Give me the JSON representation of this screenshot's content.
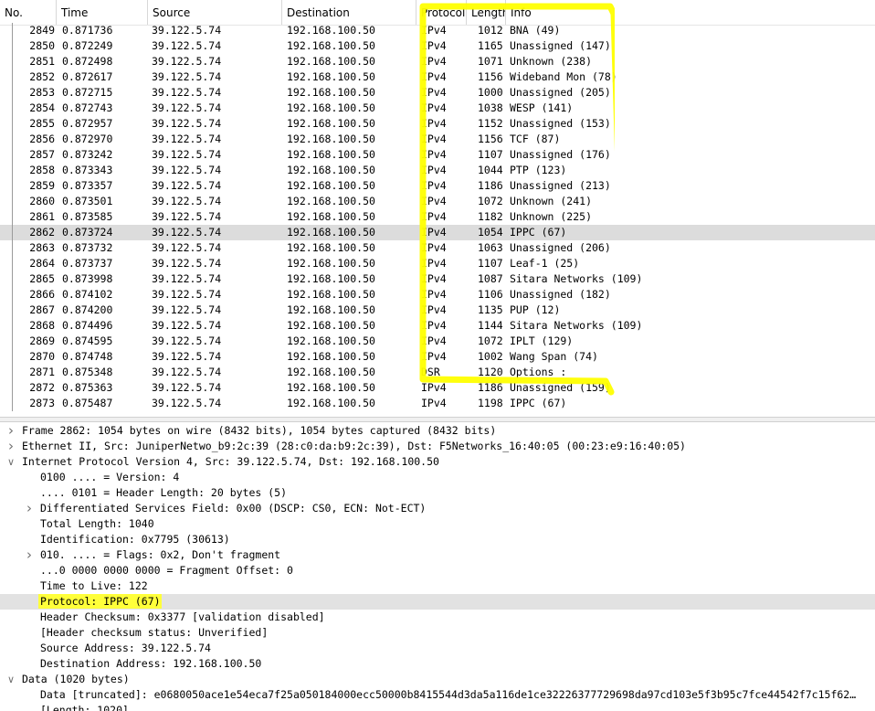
{
  "columns": {
    "no": "No.",
    "time": "Time",
    "source": "Source",
    "destination": "Destination",
    "protocol": "Protocol",
    "length": "Length",
    "info": "Info"
  },
  "packets": [
    {
      "no": "2849",
      "time": "0.871736",
      "src": "39.122.5.74",
      "dst": "192.168.100.50",
      "proto": "IPv4",
      "len": "1012",
      "info": "BNA (49)"
    },
    {
      "no": "2850",
      "time": "0.872249",
      "src": "39.122.5.74",
      "dst": "192.168.100.50",
      "proto": "IPv4",
      "len": "1165",
      "info": "Unassigned (147)"
    },
    {
      "no": "2851",
      "time": "0.872498",
      "src": "39.122.5.74",
      "dst": "192.168.100.50",
      "proto": "IPv4",
      "len": "1071",
      "info": "Unknown (238)"
    },
    {
      "no": "2852",
      "time": "0.872617",
      "src": "39.122.5.74",
      "dst": "192.168.100.50",
      "proto": "IPv4",
      "len": "1156",
      "info": "Wideband Mon (78)"
    },
    {
      "no": "2853",
      "time": "0.872715",
      "src": "39.122.5.74",
      "dst": "192.168.100.50",
      "proto": "IPv4",
      "len": "1000",
      "info": "Unassigned (205)"
    },
    {
      "no": "2854",
      "time": "0.872743",
      "src": "39.122.5.74",
      "dst": "192.168.100.50",
      "proto": "IPv4",
      "len": "1038",
      "info": "WESP (141)"
    },
    {
      "no": "2855",
      "time": "0.872957",
      "src": "39.122.5.74",
      "dst": "192.168.100.50",
      "proto": "IPv4",
      "len": "1152",
      "info": "Unassigned (153)"
    },
    {
      "no": "2856",
      "time": "0.872970",
      "src": "39.122.5.74",
      "dst": "192.168.100.50",
      "proto": "IPv4",
      "len": "1156",
      "info": "TCF (87)"
    },
    {
      "no": "2857",
      "time": "0.873242",
      "src": "39.122.5.74",
      "dst": "192.168.100.50",
      "proto": "IPv4",
      "len": "1107",
      "info": "Unassigned (176)"
    },
    {
      "no": "2858",
      "time": "0.873343",
      "src": "39.122.5.74",
      "dst": "192.168.100.50",
      "proto": "IPv4",
      "len": "1044",
      "info": "PTP (123)"
    },
    {
      "no": "2859",
      "time": "0.873357",
      "src": "39.122.5.74",
      "dst": "192.168.100.50",
      "proto": "IPv4",
      "len": "1186",
      "info": "Unassigned (213)"
    },
    {
      "no": "2860",
      "time": "0.873501",
      "src": "39.122.5.74",
      "dst": "192.168.100.50",
      "proto": "IPv4",
      "len": "1072",
      "info": "Unknown (241)"
    },
    {
      "no": "2861",
      "time": "0.873585",
      "src": "39.122.5.74",
      "dst": "192.168.100.50",
      "proto": "IPv4",
      "len": "1182",
      "info": "Unknown (225)"
    },
    {
      "no": "2862",
      "time": "0.873724",
      "src": "39.122.5.74",
      "dst": "192.168.100.50",
      "proto": "IPv4",
      "len": "1054",
      "info": "IPPC (67)",
      "selected": true
    },
    {
      "no": "2863",
      "time": "0.873732",
      "src": "39.122.5.74",
      "dst": "192.168.100.50",
      "proto": "IPv4",
      "len": "1063",
      "info": "Unassigned (206)"
    },
    {
      "no": "2864",
      "time": "0.873737",
      "src": "39.122.5.74",
      "dst": "192.168.100.50",
      "proto": "IPv4",
      "len": "1107",
      "info": "Leaf-1 (25)"
    },
    {
      "no": "2865",
      "time": "0.873998",
      "src": "39.122.5.74",
      "dst": "192.168.100.50",
      "proto": "IPv4",
      "len": "1087",
      "info": "Sitara Networks (109)"
    },
    {
      "no": "2866",
      "time": "0.874102",
      "src": "39.122.5.74",
      "dst": "192.168.100.50",
      "proto": "IPv4",
      "len": "1106",
      "info": "Unassigned (182)"
    },
    {
      "no": "2867",
      "time": "0.874200",
      "src": "39.122.5.74",
      "dst": "192.168.100.50",
      "proto": "IPv4",
      "len": "1135",
      "info": "PUP (12)"
    },
    {
      "no": "2868",
      "time": "0.874496",
      "src": "39.122.5.74",
      "dst": "192.168.100.50",
      "proto": "IPv4",
      "len": "1144",
      "info": "Sitara Networks (109)"
    },
    {
      "no": "2869",
      "time": "0.874595",
      "src": "39.122.5.74",
      "dst": "192.168.100.50",
      "proto": "IPv4",
      "len": "1072",
      "info": "IPLT (129)"
    },
    {
      "no": "2870",
      "time": "0.874748",
      "src": "39.122.5.74",
      "dst": "192.168.100.50",
      "proto": "IPv4",
      "len": "1002",
      "info": "Wang Span (74)"
    },
    {
      "no": "2871",
      "time": "0.875348",
      "src": "39.122.5.74",
      "dst": "192.168.100.50",
      "proto": "DSR",
      "len": "1120",
      "info": "Options :"
    },
    {
      "no": "2872",
      "time": "0.875363",
      "src": "39.122.5.74",
      "dst": "192.168.100.50",
      "proto": "IPv4",
      "len": "1186",
      "info": "Unassigned (159)"
    },
    {
      "no": "2873",
      "time": "0.875487",
      "src": "39.122.5.74",
      "dst": "192.168.100.50",
      "proto": "IPv4",
      "len": "1198",
      "info": "IPPC (67)"
    }
  ],
  "details": [
    {
      "indent": 0,
      "arrow": "collapsed",
      "text": "Frame 2862: 1054 bytes on wire (8432 bits), 1054 bytes captured (8432 bits)"
    },
    {
      "indent": 0,
      "arrow": "collapsed",
      "text": "Ethernet II, Src: JuniperNetwo_b9:2c:39 (28:c0:da:b9:2c:39), Dst: F5Networks_16:40:05 (00:23:e9:16:40:05)"
    },
    {
      "indent": 0,
      "arrow": "expanded",
      "text": "Internet Protocol Version 4, Src: 39.122.5.74, Dst: 192.168.100.50"
    },
    {
      "indent": 1,
      "arrow": "none",
      "text": "0100 .... = Version: 4"
    },
    {
      "indent": 1,
      "arrow": "none",
      "text": ".... 0101 = Header Length: 20 bytes (5)"
    },
    {
      "indent": 1,
      "arrow": "collapsed",
      "text": "Differentiated Services Field: 0x00 (DSCP: CS0, ECN: Not-ECT)"
    },
    {
      "indent": 1,
      "arrow": "none",
      "text": "Total Length: 1040"
    },
    {
      "indent": 1,
      "arrow": "none",
      "text": "Identification: 0x7795 (30613)"
    },
    {
      "indent": 1,
      "arrow": "collapsed",
      "text": "010. .... = Flags: 0x2, Don't fragment"
    },
    {
      "indent": 1,
      "arrow": "none",
      "text": "...0 0000 0000 0000 = Fragment Offset: 0"
    },
    {
      "indent": 1,
      "arrow": "none",
      "text": "Time to Live: 122"
    },
    {
      "indent": 1,
      "arrow": "none",
      "text": "Protocol: IPPC (67)",
      "selected": true,
      "highlight": true
    },
    {
      "indent": 1,
      "arrow": "none",
      "text": "Header Checksum: 0x3377 [validation disabled]"
    },
    {
      "indent": 1,
      "arrow": "none",
      "text": "[Header checksum status: Unverified]"
    },
    {
      "indent": 1,
      "arrow": "none",
      "text": "Source Address: 39.122.5.74"
    },
    {
      "indent": 1,
      "arrow": "none",
      "text": "Destination Address: 192.168.100.50"
    },
    {
      "indent": 0,
      "arrow": "expanded",
      "text": "Data (1020 bytes)"
    },
    {
      "indent": 1,
      "arrow": "none",
      "text": "Data [truncated]: e0680050ace1e54eca7f25a050184000ecc50000b8415544d3da5a116de1ce32226377729698da97cd103e5f3b95c7fce44542f7c15f62…"
    },
    {
      "indent": 1,
      "arrow": "none",
      "text": "[Length: 1020]"
    }
  ],
  "colors": {
    "highlight": "#ffff00",
    "selected_row": "#dcdcdc"
  }
}
